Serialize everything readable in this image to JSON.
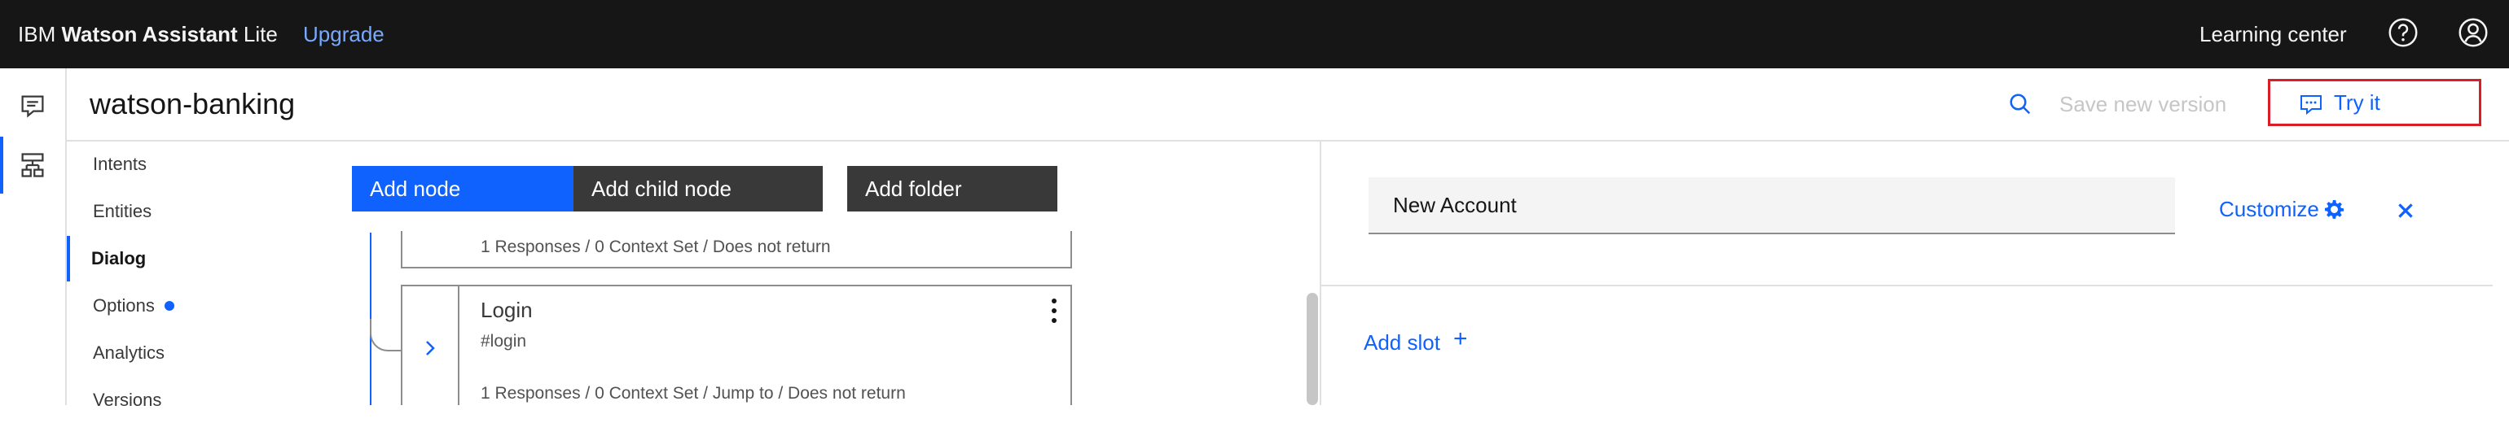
{
  "topbar": {
    "brand_prefix": "IBM",
    "brand_bold": "Watson Assistant",
    "brand_suffix": "Lite",
    "upgrade_label": "Upgrade",
    "learning_center_label": "Learning center"
  },
  "header": {
    "skill_name": "watson-banking",
    "save_version_label": "Save new version",
    "try_it_label": "Try it"
  },
  "sidenav": {
    "items": [
      {
        "label": "Intents"
      },
      {
        "label": "Entities"
      },
      {
        "label": "Dialog",
        "active": true
      },
      {
        "label": "Options",
        "badge": true
      },
      {
        "label": "Analytics"
      },
      {
        "label": "Versions"
      }
    ]
  },
  "toolbar": {
    "add_node_label": "Add node",
    "add_child_node_label": "Add child node",
    "add_folder_label": "Add folder"
  },
  "tree": {
    "previous_node_meta": "1 Responses / 0 Context Set / Does not return",
    "node": {
      "title": "Login",
      "condition": "#login",
      "meta": "1 Responses / 0 Context Set / Jump to / Does not return"
    }
  },
  "editor": {
    "node_name_value": "New Account",
    "customize_label": "Customize",
    "add_slot_label": "Add slot",
    "add_slot_plus": "+"
  },
  "colors": {
    "accent": "#0f62fe",
    "topbar_bg": "#161616",
    "highlight_border": "#da1e28",
    "dark_button": "#393939"
  }
}
